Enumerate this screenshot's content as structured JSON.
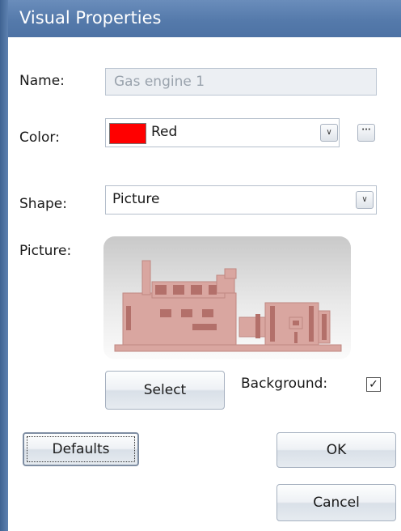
{
  "window": {
    "title": "Visual Properties"
  },
  "name": {
    "label": "Name:",
    "value": "Gas engine 1"
  },
  "color": {
    "label": "Color:",
    "value": "Red",
    "swatch": "#ff0000",
    "dropdown_icon": "chevron-down",
    "more_icon": "ellipsis"
  },
  "shape": {
    "label": "Shape:",
    "value": "Picture",
    "dropdown_icon": "chevron-down"
  },
  "picture": {
    "label": "Picture:",
    "image": "gas-engine-generator"
  },
  "buttons": {
    "select": "Select",
    "defaults": "Defaults",
    "ok": "OK",
    "cancel": "Cancel"
  },
  "background": {
    "label": "Background:",
    "checked": true
  }
}
